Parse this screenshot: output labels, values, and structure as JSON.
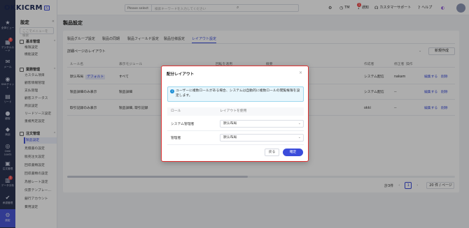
{
  "rail": {
    "items": [
      {
        "label": "全体ビュー",
        "icon": "star-icon"
      },
      {
        "label": "デジタルカード",
        "icon": "card-icon",
        "badge": "7"
      },
      {
        "label": "メール",
        "icon": "mail-icon"
      },
      {
        "label": "SNSチャット",
        "icon": "chat-icon"
      },
      {
        "label": "リード",
        "icon": "lead-icon"
      },
      {
        "label": "顧客",
        "icon": "customer-icon"
      },
      {
        "label": "商談",
        "icon": "deal-icon"
      },
      {
        "label": "OKKI Leads",
        "icon": "leads-icon"
      },
      {
        "label": "注文管理",
        "icon": "order-icon"
      },
      {
        "label": "データ分析",
        "icon": "chart-icon",
        "badge": "1"
      },
      {
        "label": "承認管理",
        "icon": "approve-icon"
      },
      {
        "label": "設定",
        "icon": "gear-icon"
      }
    ]
  },
  "nav": {
    "title": "設定",
    "search_placeholder": "ここでメニューを検索",
    "groups": [
      {
        "label": "基本管理",
        "items": [
          "権限設定",
          "機能設定"
        ]
      },
      {
        "label": "業務管理",
        "items": [
          "カスタム項目",
          "顧客情報管理",
          "支払管理",
          "顧客ステータス",
          "商談設定",
          "リードソース設定",
          "重複判定設定"
        ]
      },
      {
        "label": "注文管理",
        "items": [
          "製品設定",
          "見積書の設定",
          "販売注文設定",
          "回収書類設定",
          "回収書類の設定",
          "為替レート設定",
          "伝票テンプレー...",
          "銀行アカウント",
          "費用設定"
        ]
      }
    ],
    "active_item": "製品設定"
  },
  "topbar": {
    "logo": "OKKICRM",
    "logo_tag": "AI",
    "search_select": "Please select",
    "search_placeholder": "検索キーワードを入力してください",
    "user": "TM",
    "notifications": "通知",
    "notification_count": "1",
    "support": "カスタマーサポート",
    "help": "ヘルプ"
  },
  "page": {
    "title": "製品設定",
    "tabs": [
      "製品グループ設定",
      "製品の同期",
      "製品フィールド設定",
      "製品仕様設定",
      "レイアウト設定"
    ],
    "active_tab": "レイアウト設定",
    "section_label": "詳細ページのレイアウト",
    "new_button": "新規作成",
    "columns": [
      "ルール名",
      "表示モジュール",
      "",
      "",
      "作成者",
      "修正者",
      "操作"
    ],
    "col_partial": [
      "回転を適用",
      "概要"
    ],
    "rows": [
      {
        "name": "默认布局",
        "tag": "デフォルト",
        "modules": "すべて",
        "creator": "システム配信",
        "modifier": "nakam",
        "edit": "編集する",
        "delete": "削除"
      },
      {
        "name": "製品詳細のみ表示",
        "modules": "製品詳細",
        "creator": "システム配信",
        "modifier": "--",
        "edit": "編集する",
        "delete": "削除"
      },
      {
        "name": "取引記録のみ表示",
        "modules": "製品詳細, 取引記録",
        "creator": "okki",
        "modifier": "--",
        "edit": "編集する",
        "delete": "削除"
      }
    ],
    "pagination": {
      "total": "計3件",
      "current": "1",
      "page_size": "20 件 / ページ"
    }
  },
  "dialog": {
    "title": "配分レイアウト",
    "note": "ユーザーに複数ロールがある場合、システムは自動的に複数ロールの閲覧権限を設定します。",
    "col_role": "ロール",
    "col_layout": "レイアウトを使用",
    "rows": [
      {
        "role": "システム管理者",
        "layout": "默认布局"
      },
      {
        "role": "管理者",
        "layout": "默认布局"
      }
    ],
    "cancel": "戻る",
    "ok": "確定"
  }
}
